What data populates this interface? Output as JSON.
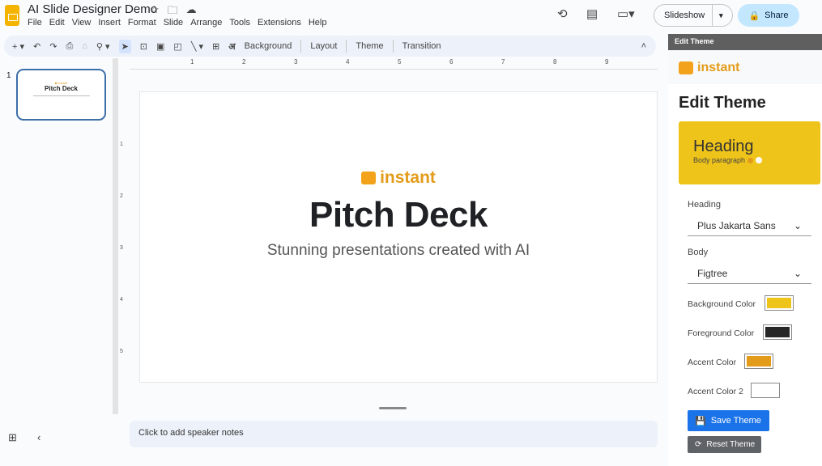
{
  "app": {
    "title": "AI Slide Designer Demo",
    "menu": [
      "File",
      "Edit",
      "View",
      "Insert",
      "Format",
      "Slide",
      "Arrange",
      "Tools",
      "Extensions",
      "Help"
    ],
    "slideshow_label": "Slideshow",
    "share_label": "Share"
  },
  "toolbar": {
    "background": "Background",
    "layout": "Layout",
    "theme": "Theme",
    "transition": "Transition"
  },
  "ruler": {
    "h": [
      "1",
      "2",
      "3",
      "4",
      "5",
      "6",
      "7",
      "8",
      "9"
    ],
    "v": [
      "1",
      "2",
      "3",
      "4",
      "5"
    ]
  },
  "filmstrip": {
    "slide_number": "1",
    "thumb_title": "Pitch Deck"
  },
  "slide": {
    "brand": "instant",
    "title": "Pitch Deck",
    "subtitle": "Stunning presentations created with AI"
  },
  "notes": {
    "placeholder": "Click to add speaker notes"
  },
  "panel": {
    "header": "Edit Theme",
    "brand": "instant",
    "title": "Edit Theme",
    "preview": {
      "heading": "Heading",
      "body": "Body paragraph"
    },
    "heading_label": "Heading",
    "heading_font": "Plus Jakarta Sans",
    "body_label": "Body",
    "body_font": "Figtree",
    "colors": [
      {
        "label": "Background Color",
        "value": "#efc41a"
      },
      {
        "label": "Foreground Color",
        "value": "#262626"
      },
      {
        "label": "Accent Color",
        "value": "#e39b1a"
      },
      {
        "label": "Accent Color 2",
        "value": "#ffffff"
      }
    ],
    "save_label": "Save Theme",
    "reset_label": "Reset Theme"
  },
  "colors": {
    "accent": "#1a73e8",
    "brand": "#e39b1a",
    "theme_bg": "#efc41a"
  }
}
